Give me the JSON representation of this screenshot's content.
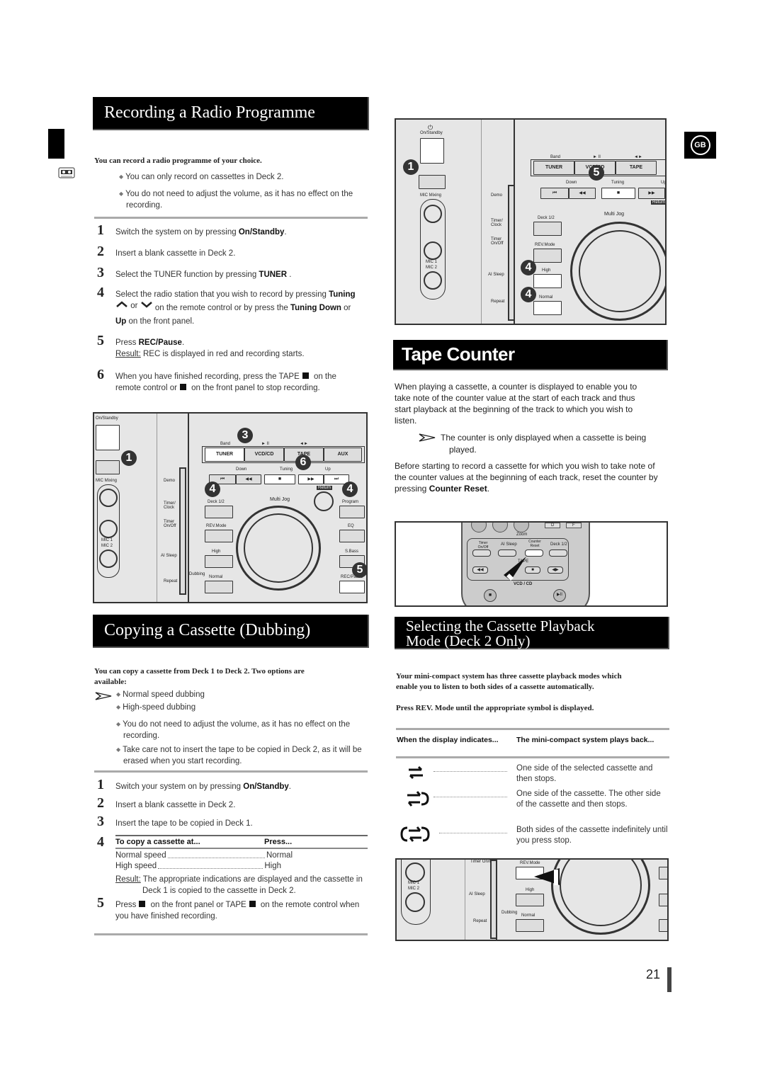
{
  "page": {
    "number": "21",
    "language_badge": "GB"
  },
  "side_tab": {
    "icon": "cassette-icon"
  },
  "recording": {
    "title": "Recording a Radio Programme",
    "intro": "You can record a radio programme of your choice.",
    "notes": [
      "You can only record on cassettes in Deck 2.",
      "You do not need to adjust the volume, as it has no effect on the recording."
    ],
    "steps": [
      {
        "num": "1",
        "pre": "Switch the system on by pressing ",
        "bold": "On/Standby",
        "post": "."
      },
      {
        "num": "2",
        "text": "Insert a blank cassette in Deck 2."
      },
      {
        "num": "3",
        "pre": "Select the TUNER function by pressing ",
        "bold": "TUNER",
        "post": " ."
      },
      {
        "num": "4",
        "line1_pre": "Select the radio station that you wish to record by pressing ",
        "line1_bold": "Tuning",
        "or": "or",
        "line2": "on the remote control or by press the ",
        "bold2": "Tuning  Down",
        "or2": " or",
        "bold3": "Up",
        "line3": " on the front panel."
      },
      {
        "num": "5",
        "pre": "Press ",
        "bold": "REC/Pause",
        "post": ".",
        "result_label": "Result:",
        "result": " REC is displayed in red and recording starts."
      },
      {
        "num": "6",
        "line1": "When you have finished recording, press the TAPE",
        "line1b": " on the",
        "line2a": "remote control  or",
        "line2b": " on the front panel to stop recording."
      }
    ]
  },
  "front_panel": {
    "on_standby": "On/Standby",
    "mic_mixing": "MIC Mixing",
    "mic1": "MIC 1",
    "mic2": "MIC 2",
    "side_labels": [
      "Demo",
      "Timer/ Clock",
      "Timer On/Off",
      "AI Sleep",
      "Repeat"
    ],
    "band": "Band",
    "play_pause": "► II",
    "tape_dir": "◄►",
    "functions": [
      "TUNER",
      "VCD/CD",
      "TAPE",
      "AUX"
    ],
    "down": "Down",
    "tuning": "Tuning",
    "up": "Up",
    "transport": [
      "⏮",
      "◀◀",
      "■",
      "▶▶",
      "⏭"
    ],
    "return": "Return",
    "multi_jog": "Multi Jog",
    "left_buttons": [
      "Deck 1/2",
      "REV.Mode",
      "High",
      "Normal"
    ],
    "dubbing": "Dubbing",
    "right_buttons": [
      "Program",
      "EQ",
      "S.Bass",
      "REC/Pause"
    ],
    "callouts_recording": [
      "1",
      "3",
      "6",
      "4",
      "4",
      "5"
    ],
    "callouts_dubbing": [
      "1",
      "5",
      "4",
      "4"
    ]
  },
  "dubbing": {
    "title": "Copying a Cassette (Dubbing)",
    "intro": "You can copy a cassette from Deck 1 to Deck 2. Two options are available:",
    "options": [
      "Normal speed dubbing",
      "High-speed dubbing"
    ],
    "notes": [
      "You do not need to adjust the volume, as it has no effect on the recording.",
      "Take care not to insert the tape to be copied in Deck 2, as it will be erased when you start recording."
    ],
    "steps": [
      {
        "num": "1",
        "pre": "Switch your system on by pressing ",
        "bold": "On/Standby",
        "post": "."
      },
      {
        "num": "2",
        "text": "Insert a blank cassette in Deck 2."
      },
      {
        "num": "3",
        "text": "Insert the tape to be copied in Deck 1."
      },
      {
        "num": "4"
      },
      {
        "num": "5",
        "a": "Press",
        "b": " on the front panel or TAPE",
        "c": " on the remote control when",
        "d": "you have finished recording."
      }
    ],
    "table": {
      "headers": [
        "To copy a cassette at...",
        "Press..."
      ],
      "rows": [
        [
          "Normal speed",
          "Normal"
        ],
        [
          "High speed",
          "High"
        ]
      ]
    },
    "result_label": "Result:",
    "result": " The appropriate indications are displayed and the cassette in",
    "result2": "Deck 1 is copied to the cassette in Deck 2."
  },
  "tape_counter": {
    "title": "Tape Counter",
    "para1": "When playing a cassette, a counter is displayed to enable you to take note of the counter value at the start of each track and thus start playback at the beginning of the track to which you wish to listen.",
    "note": "The counter is only displayed when a cassette is being",
    "note2": "played.",
    "para2_pre": "Before starting to record a cassette for which you wish to take note of the counter values at the beginning of each track, reset the counter by pressing ",
    "para2_bold": "Counter Reset",
    "para2_post": ".",
    "remote": {
      "zoom": "Zoom",
      "buttons": [
        "Timer On/Off",
        "AI Sleep",
        "Counter Reset",
        "Deck 1/2"
      ],
      "tape_label": "TAPE",
      "vcd": "VCD / CD",
      "keys": [
        "D",
        "F"
      ]
    }
  },
  "playback": {
    "title_line1": "Selecting the Cassette Playback",
    "title_line2": "Mode (Deck 2 Only)",
    "intro": "Your mini-compact system has three cassette playback modes which enable you to listen to both sides of a cassette automatically.",
    "instruction": "Press REV. Mode until the appropriate symbol is displayed.",
    "headers": [
      "When the display indicates...",
      "The mini-compact system plays back..."
    ],
    "modes": [
      {
        "icon": "one-side-icon",
        "text": "One side of the selected cassette and then stops."
      },
      {
        "icon": "both-sides-once-icon",
        "text": "One side of the cassette. The other side of the cassette and then stops."
      },
      {
        "icon": "repeat-both-icon",
        "text": "Both sides of the cassette indefinitely until you press stop."
      }
    ]
  }
}
